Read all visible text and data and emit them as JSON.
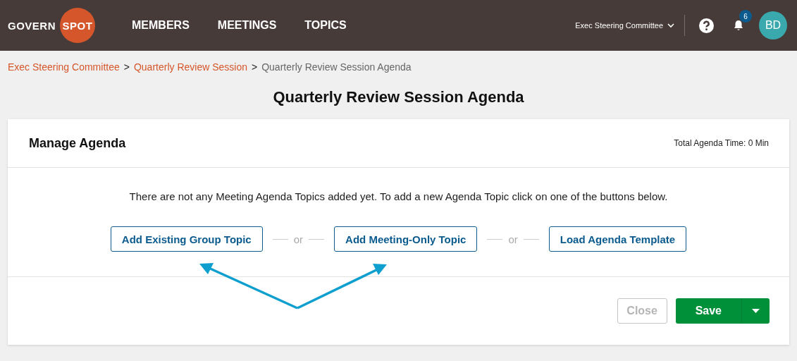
{
  "header": {
    "logo": {
      "word_1": "GOVERN",
      "word_2": "SPOT"
    },
    "nav": [
      "MEMBERS",
      "MEETINGS",
      "TOPICS"
    ],
    "committee_selector": "Exec Steering Committee",
    "notifications": {
      "count": "6"
    },
    "avatar": "BD"
  },
  "breadcrumbs": [
    {
      "label": "Exec Steering Committee",
      "kind": "link"
    },
    {
      "separator": ">",
      "label": "Quarterly Review Session",
      "kind": "link"
    },
    {
      "separator": ">",
      "label": "Quarterly Review Session Agenda",
      "kind": "current"
    }
  ],
  "page_title": "Quarterly Review Session Agenda",
  "card": {
    "title": "Manage Agenda",
    "total_time": "Total Agenda Time: 0 Min",
    "message": "There are not any Meeting Agenda Topics added yet. To add a new Agenda Topic click on one of the buttons below.",
    "actions": [
      {
        "kind": "button",
        "label": "Add Existing Group Topic"
      },
      {
        "kind": "separator",
        "label": "or"
      },
      {
        "kind": "button",
        "label": "Add Meeting-Only Topic"
      },
      {
        "kind": "separator",
        "label": "or"
      },
      {
        "kind": "button",
        "label": "Load Agenda Template"
      }
    ],
    "footer": {
      "close": {
        "label": "Close",
        "disabled": true
      },
      "save": {
        "label": "Save"
      }
    }
  }
}
